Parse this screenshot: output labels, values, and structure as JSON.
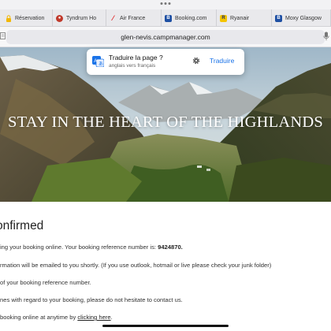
{
  "browser": {
    "tabs": [
      {
        "label": "Réservation",
        "icon": "lock-icon",
        "color": "#f2b705"
      },
      {
        "label": "Tyndrum Ho",
        "icon": "globe-icon",
        "color": "#c0392b"
      },
      {
        "label": "Air France",
        "icon": "airfrance-icon",
        "color": "#e02020"
      },
      {
        "label": "Booking.com",
        "icon": "booking-icon",
        "color": "#1e4fa3"
      },
      {
        "label": "Ryanair",
        "icon": "ryanair-icon",
        "color": "#f4c400"
      },
      {
        "label": "Moxy Glasgow",
        "icon": "booking-icon",
        "color": "#1e4fa3"
      }
    ],
    "url": "glen-nevis.campmanager.com"
  },
  "translate_popup": {
    "title": "Traduire la page ?",
    "subtitle": "anglais vers français",
    "button": "Traduire"
  },
  "hero": {
    "title": "STAY IN THE HEART OF THE HIGHLANDS"
  },
  "confirmation": {
    "heading": "onfirmed",
    "line1_text": "ing your booking online. Your booking reference number is: ",
    "reference": "9424870.",
    "line2": "rmation will be emailed to you shortly. (If you use outlook, hotmail or live please check your junk folder)",
    "line3": " of your booking reference number.",
    "line4": "nes with regard to your booking, please do not hesitate to contact us.",
    "line5_text": "booking online at anytime by ",
    "line5_link": "clicking here",
    "line5_end": "."
  }
}
